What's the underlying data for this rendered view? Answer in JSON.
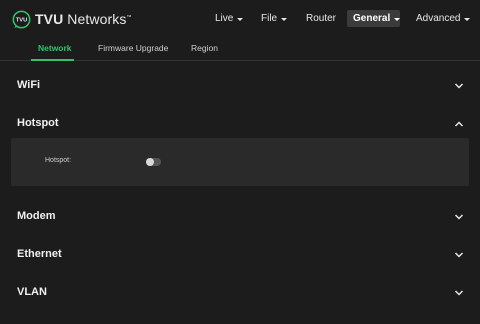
{
  "brand": {
    "name_bold": "TVU",
    "name_rest": " Networks",
    "accent": "#33c26a"
  },
  "nav": {
    "live": "Live",
    "file": "File",
    "router": "Router",
    "general": "General",
    "advanced": "Advanced"
  },
  "subtabs": {
    "network": "Network",
    "firmware": "Firmware Upgrade",
    "region": "Region",
    "active": "Network"
  },
  "sections": {
    "wifi": "WiFi",
    "hotspot": "Hotspot",
    "modem": "Modem",
    "ethernet": "Ethernet",
    "vlan": "VLAN"
  },
  "hotspot_panel": {
    "label": "Hotspot:",
    "toggle_on": false
  }
}
